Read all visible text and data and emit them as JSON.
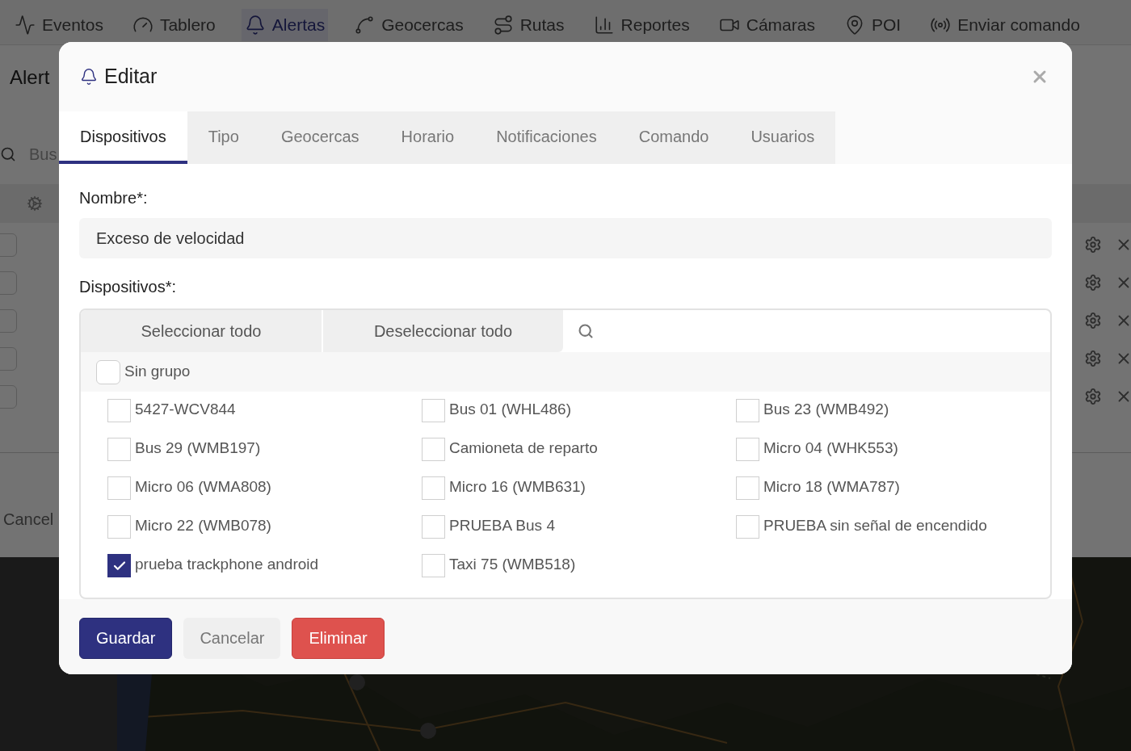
{
  "nav": [
    {
      "label": "Eventos",
      "selected": false
    },
    {
      "label": "Tablero",
      "selected": false
    },
    {
      "label": "Alertas",
      "selected": true
    },
    {
      "label": "Geocercas",
      "selected": false
    },
    {
      "label": "Rutas",
      "selected": false
    },
    {
      "label": "Reportes",
      "selected": false
    },
    {
      "label": "Cámaras",
      "selected": false
    },
    {
      "label": "POI",
      "selected": false
    },
    {
      "label": "Enviar comando",
      "selected": false
    }
  ],
  "background": {
    "title": "Alert",
    "search_placeholder": "Bus",
    "rows": [
      {
        "checked": false
      },
      {
        "checked": false
      },
      {
        "checked": false
      },
      {
        "checked": false
      },
      {
        "checked": false
      }
    ],
    "cancel": "Cancel"
  },
  "modal": {
    "title": "Editar",
    "tabs": [
      {
        "label": "Dispositivos",
        "selected": true
      },
      {
        "label": "Tipo",
        "selected": false
      },
      {
        "label": "Geocercas",
        "selected": false
      },
      {
        "label": "Horario",
        "selected": false
      },
      {
        "label": "Notificaciones",
        "selected": false
      },
      {
        "label": "Comando",
        "selected": false
      },
      {
        "label": "Usuarios",
        "selected": false
      }
    ],
    "name_label": "Nombre*:",
    "name_value": "Exceso de velocidad",
    "devices_label": "Dispositivos*:",
    "select_all": "Seleccionar todo",
    "deselect_all": "Deseleccionar todo",
    "group": {
      "label": "Sin grupo",
      "checked": false
    },
    "devices": [
      {
        "label": "5427-WCV844",
        "checked": false
      },
      {
        "label": "Bus 01 (WHL486)",
        "checked": false
      },
      {
        "label": "Bus 23 (WMB492)",
        "checked": false
      },
      {
        "label": "Bus 29 (WMB197)",
        "checked": false
      },
      {
        "label": "Camioneta de reparto",
        "checked": false
      },
      {
        "label": "Micro 04 (WHK553)",
        "checked": false
      },
      {
        "label": "Micro 06 (WMA808)",
        "checked": false
      },
      {
        "label": "Micro 16 (WMB631)",
        "checked": false
      },
      {
        "label": "Micro 18 (WMA787)",
        "checked": false
      },
      {
        "label": "Micro 22 (WMB078)",
        "checked": false
      },
      {
        "label": "PRUEBA Bus 4",
        "checked": false
      },
      {
        "label": "PRUEBA sin señal de encendido",
        "checked": false
      },
      {
        "label": "prueba trackphone android",
        "checked": true
      },
      {
        "label": "Taxi 75 (WMB518)",
        "checked": false
      }
    ],
    "buttons": [
      {
        "label": "Guardar",
        "kind": "primary"
      },
      {
        "label": "Cancelar",
        "kind": "default"
      },
      {
        "label": "Eliminar",
        "kind": "danger"
      }
    ]
  }
}
